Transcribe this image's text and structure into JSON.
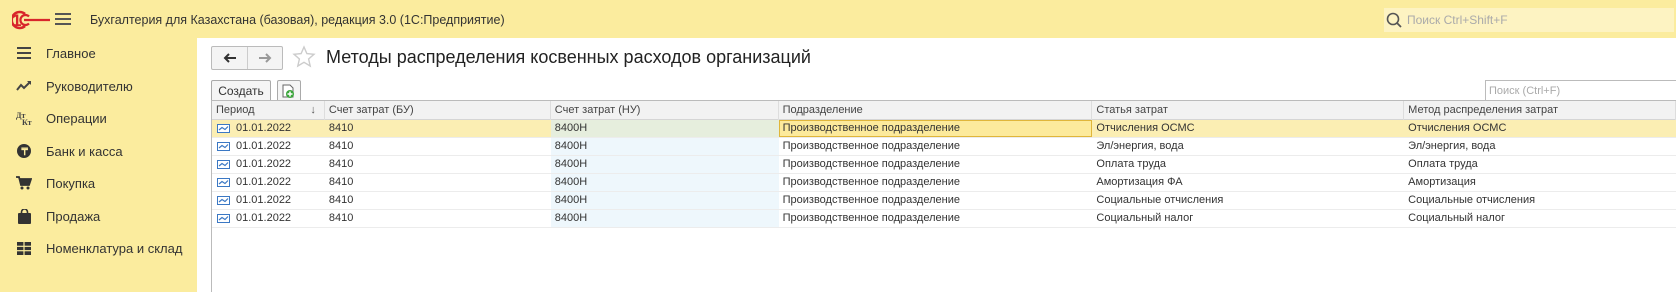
{
  "app": {
    "title": "Бухгалтерия для Казахстана (базовая), редакция 3.0  (1С:Предприятие)",
    "search_placeholder": "Поиск Ctrl+Shift+F"
  },
  "sidebar": {
    "items": [
      {
        "label": "Главное",
        "icon": "menu-lines-icon"
      },
      {
        "label": "Руководителю",
        "icon": "trend-chart-icon"
      },
      {
        "label": "Операции",
        "icon": "debit-credit-icon"
      },
      {
        "label": "Банк и касса",
        "icon": "coin-icon"
      },
      {
        "label": "Покупка",
        "icon": "cart-icon"
      },
      {
        "label": "Продажа",
        "icon": "bag-icon"
      },
      {
        "label": "Номенклатура и склад",
        "icon": "grid-icon"
      }
    ]
  },
  "form": {
    "title": "Методы распределения косвенных расходов организаций",
    "create_label": "Создать",
    "list_search_placeholder": "Поиск (Ctrl+F)"
  },
  "table": {
    "columns": [
      "Период",
      "Счет затрат (БУ)",
      "Счет затрат (НУ)",
      "Подразделение",
      "Статья затрат",
      "Метод распределения затрат"
    ],
    "sort_indicator": "↓",
    "rows": [
      {
        "period": "01.01.2022",
        "bu": "8410",
        "nu": "8400Н",
        "dept": "Производственное подразделение",
        "article": "Отчисления ОСМС",
        "method": "Отчисления ОСМС"
      },
      {
        "period": "01.01.2022",
        "bu": "8410",
        "nu": "8400Н",
        "dept": "Производственное подразделение",
        "article": "Эл/энергия, вода",
        "method": "Эл/энергия, вода"
      },
      {
        "period": "01.01.2022",
        "bu": "8410",
        "nu": "8400Н",
        "dept": "Производственное подразделение",
        "article": "Оплата труда",
        "method": "Оплата труда"
      },
      {
        "period": "01.01.2022",
        "bu": "8410",
        "nu": "8400Н",
        "dept": "Производственное подразделение",
        "article": "Амортизация ФА",
        "method": "Амортизация"
      },
      {
        "period": "01.01.2022",
        "bu": "8410",
        "nu": "8400Н",
        "dept": "Производственное подразделение",
        "article": "Социальные отчисления",
        "method": "Социальные отчисления"
      },
      {
        "period": "01.01.2022",
        "bu": "8410",
        "nu": "8400Н",
        "dept": "Производственное подразделение",
        "article": "Социальный налог",
        "method": "Социальный налог"
      }
    ]
  },
  "colors": {
    "header_bg": "#fbec9e",
    "selected_row": "#fbeeb3",
    "logo_red": "#d8262b"
  }
}
